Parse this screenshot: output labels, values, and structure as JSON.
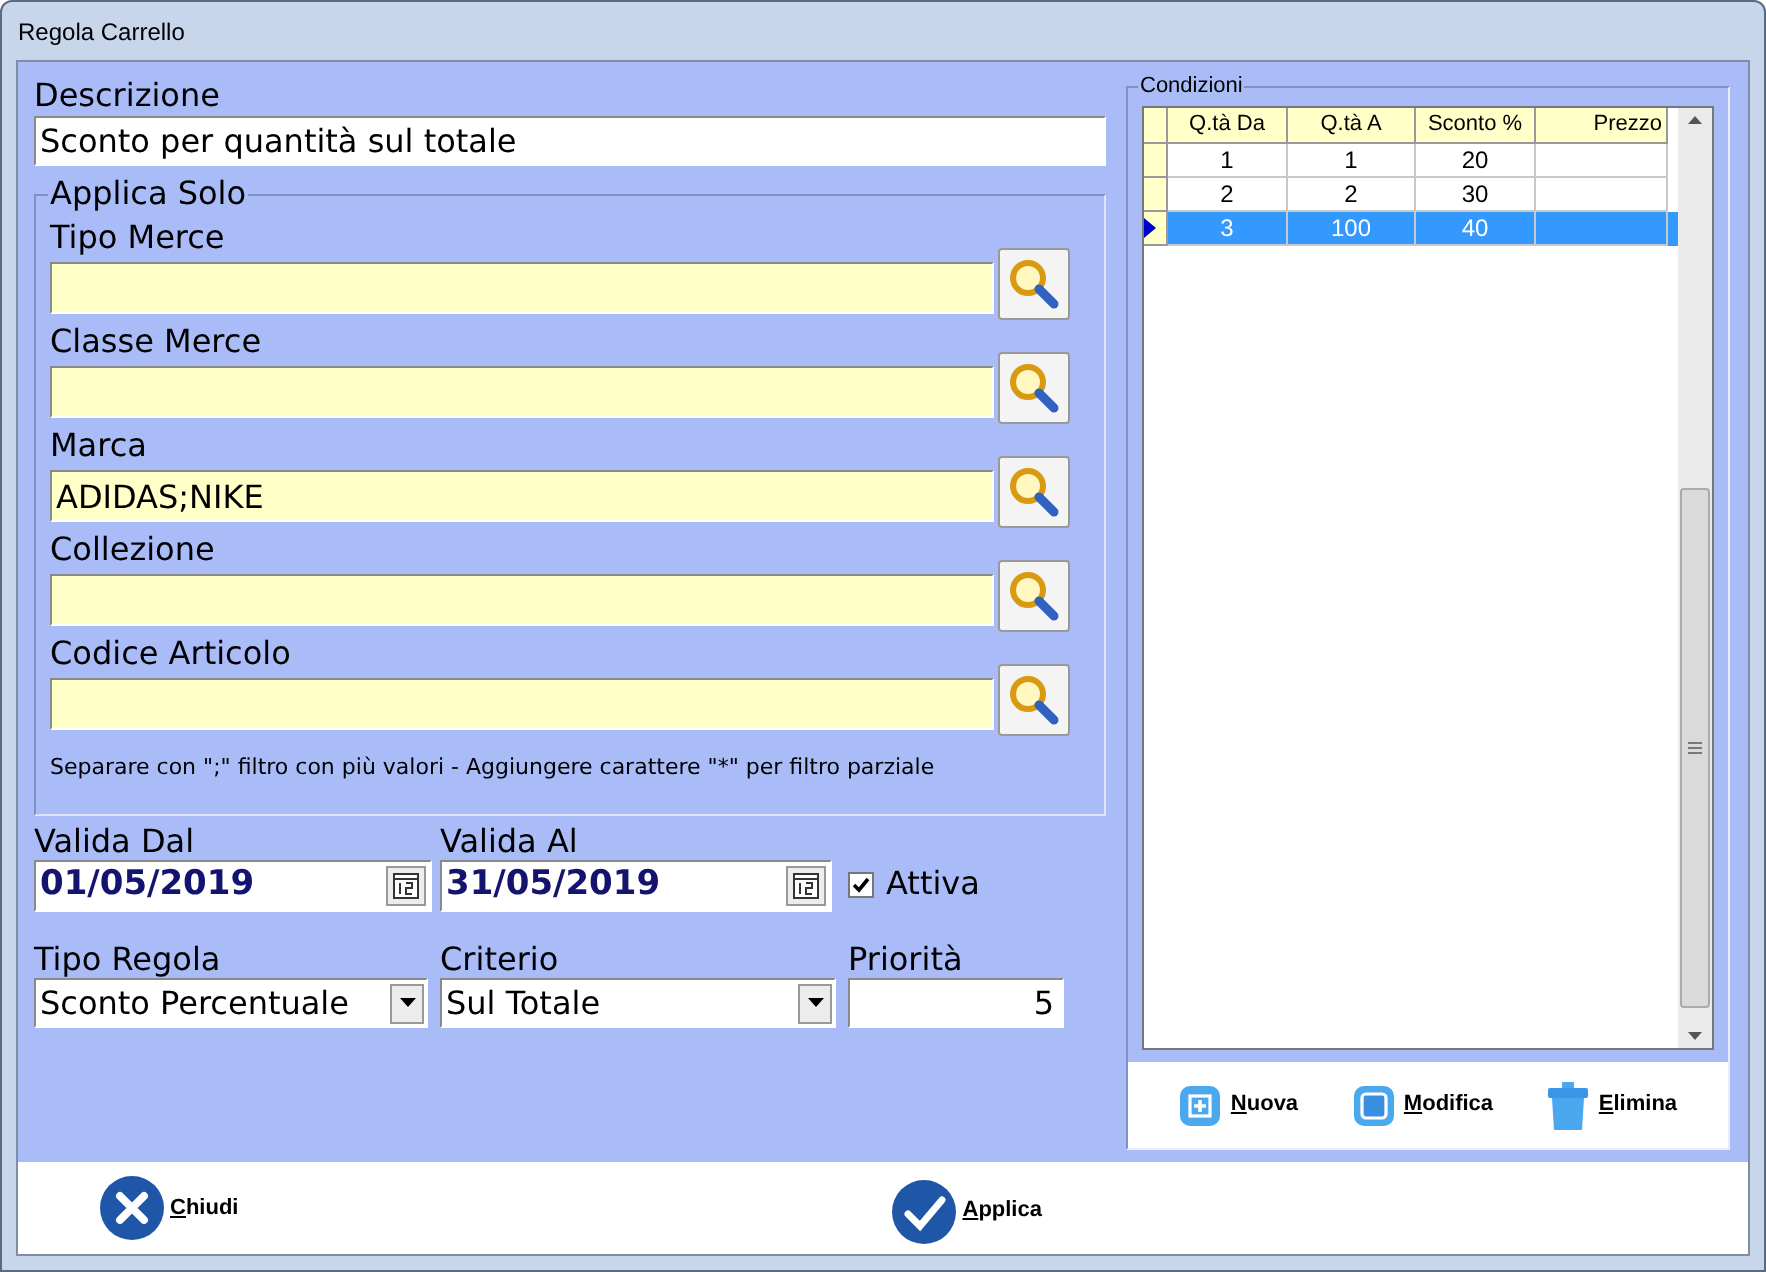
{
  "window": {
    "title": "Regola Carrello"
  },
  "description": {
    "label": "Descrizione",
    "value": "Sconto per quantità sul totale"
  },
  "filters": {
    "title": "Applica Solo",
    "fields": [
      {
        "label": "Tipo Merce"
      },
      {
        "label": "Classe Merce"
      },
      {
        "label": "Marca",
        "value": "ADIDAS;NIKE"
      },
      {
        "label": "Collezione"
      },
      {
        "label": "Codice Articolo"
      }
    ],
    "note": "Separare con \";\" filtro con più valori - Aggiungere carattere \"*\" per filtro parziale"
  },
  "validity": [
    {
      "label": "Valida Dal",
      "value": "01/05/2019"
    },
    {
      "label": "Valida Al",
      "value": "31/05/2019"
    }
  ],
  "active": {
    "label": "Attiva",
    "checked": true
  },
  "rule_type": {
    "label": "Tipo Regola",
    "value": "Sconto Percentuale"
  },
  "criterion": {
    "label": "Criterio",
    "value": "Sul Totale"
  },
  "priority": {
    "label": "Priorità",
    "value": "5"
  },
  "conditions": {
    "title": "Condizioni",
    "columns": [
      "Q.tà Da",
      "Q.tà A",
      "Sconto %",
      "Prezzo"
    ],
    "rows": [
      {
        "cells": [
          "1",
          "1",
          "20"
        ],
        "selected": false
      },
      {
        "cells": [
          "2",
          "2",
          "30"
        ],
        "selected": false
      },
      {
        "cells": [
          "3",
          "100",
          "40"
        ],
        "selected": true
      }
    ],
    "buttons": [
      {
        "label": "Nuova",
        "kind": "add"
      },
      {
        "label": "Modifica",
        "kind": "edit"
      },
      {
        "label": "Elimina",
        "kind": "delete"
      }
    ]
  },
  "footer": [
    {
      "label": "Chiudi",
      "kind": "close"
    },
    {
      "label": "Applica",
      "kind": "apply"
    }
  ]
}
